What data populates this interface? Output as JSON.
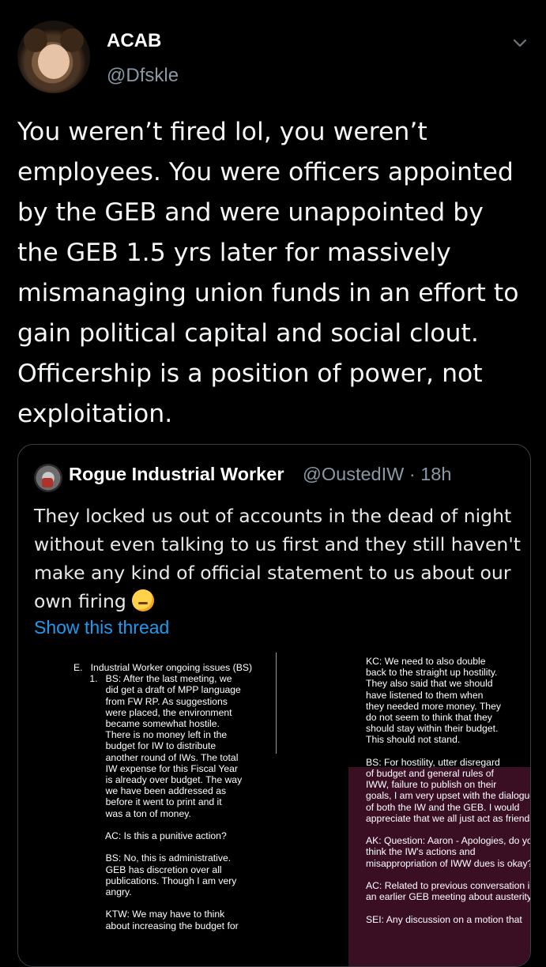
{
  "author": {
    "name": "ACAB",
    "handle": "@Dfskle"
  },
  "tweet": {
    "text": "You weren’t fired lol, you weren’t employees. You were officers appointed by the GEB and were unappointed by the GEB 1.5 yrs later for massively mismanaging union funds in an effort to gain political capital and social clout. Officership is a position of power, not exploitation."
  },
  "quoted": {
    "name": "Rogue Industrial Worker",
    "handle": "@OustedIW",
    "time": "· 18h",
    "text": "They locked us out of accounts in the dead of night without even talking to us first and they still haven't make any kind of official statement to us about our own firing",
    "show_thread": "Show this thread"
  },
  "document": {
    "left_column": "E.   Industrial Worker ongoing issues (BS)\n      1.   BS: After the last meeting, we\n            did get a draft of MPP language\n            from FW RP. As suggestions\n            were placed, the environment\n            became somewhat hostile.\n            There is no money left in the\n            budget for IW to distribute\n            another round of IWs. The total\n            IW expense for this Fiscal Year\n            is already over budget. The way\n            we have been addressed as\n            before it went to print and it\n            was a ton of money.\n\n            AC: Is this a punitive action?\n\n            BS: No, this is administrative.\n            GEB has discretion over all\n            publications. Though I am very\n            angry.\n\n            KTW: We may have to think\n            about increasing the budget for",
    "right_column": "KC: We need to also double\nback to the straight up hostility.\nThey also said that we should\nhave listened to them when\nthey needed more money. They\ndo not seem to think that they\nshould stay within their budget.\nThis should not stand.\n\nBS: For hostility, utter disregard\nof budget and general rules of\nIWW, failure to publish on their\ngoals, I am very upset with the dialogue\nof both the IW and the GEB. I would\nappreciate that we all just act as friends.\n\nAK: Question: Aaron - Apologies, do you\nthink the IW's actions and\nmisappropriation of IWW dues is okay?\n\nAC: Related to previous conversation in\nan earlier GEB meeting about austerity.\n\nSEI: Any discussion on a motion that"
  },
  "colors": {
    "background": "#000000",
    "text": "#e7e9ea",
    "secondary": "#8b98a5",
    "link": "#1d9bf0",
    "border": "#3a3f44"
  },
  "icons": {
    "menu": "chevron-down-icon",
    "emoji": "thinking-face-emoji"
  }
}
